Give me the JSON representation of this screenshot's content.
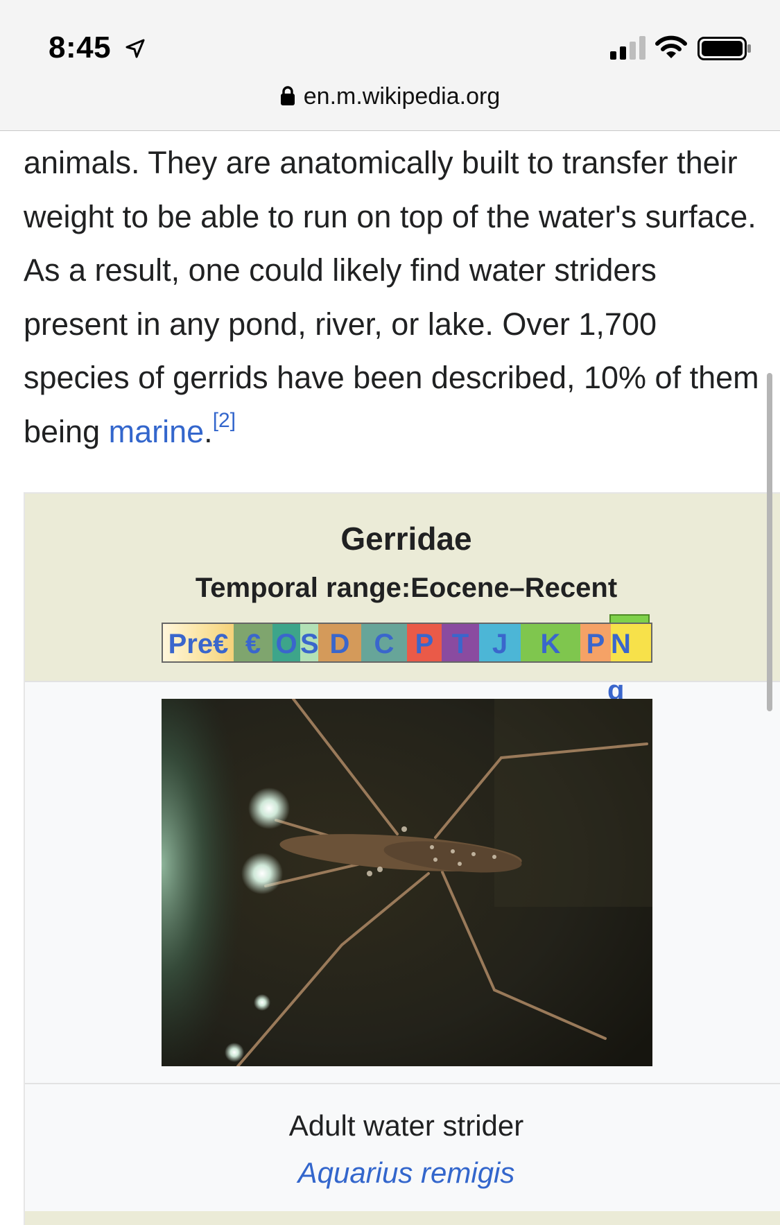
{
  "status_bar": {
    "time": "8:45",
    "signal_bars_active": 2,
    "signal_bars_total": 4
  },
  "browser": {
    "url": "en.m.wikipedia.org"
  },
  "article": {
    "text_before_link": "animals. They are anatomically built to transfer their weight to be able to run on top of the water's surface. As a result, one could likely find water striders present in any pond, river, or lake. Over 1,700 species of gerrids have been described, 10% of them being ",
    "link_text": "marine",
    "text_after_link": ".",
    "citation": "[2]"
  },
  "infobox": {
    "title": "Gerridae",
    "temporal_range_label": "Temporal range:",
    "temporal_range_value": "Eocene–Recent",
    "timeline_periods": [
      {
        "label": "Pre€",
        "color": "#fbe6a8"
      },
      {
        "label": "€",
        "color": "#7fa56e"
      },
      {
        "label": "O",
        "color": "#019a72"
      },
      {
        "label": "S",
        "color": "#b3e1b6"
      },
      {
        "label": "D",
        "color": "#cb8c37"
      },
      {
        "label": "C",
        "color": "#67a599"
      },
      {
        "label": "P",
        "color": "#f04028"
      },
      {
        "label": "T",
        "color": "#812b92"
      },
      {
        "label": "J",
        "color": "#34b2c9"
      },
      {
        "label": "K",
        "color": "#7fc64e"
      },
      {
        "label": "P",
        "color": "#fd9a52"
      },
      {
        "label": "N",
        "color": "#ffe619"
      }
    ],
    "ng_overflow": "g",
    "caption": "Adult water strider",
    "species_link": "Aquarius remigis"
  }
}
